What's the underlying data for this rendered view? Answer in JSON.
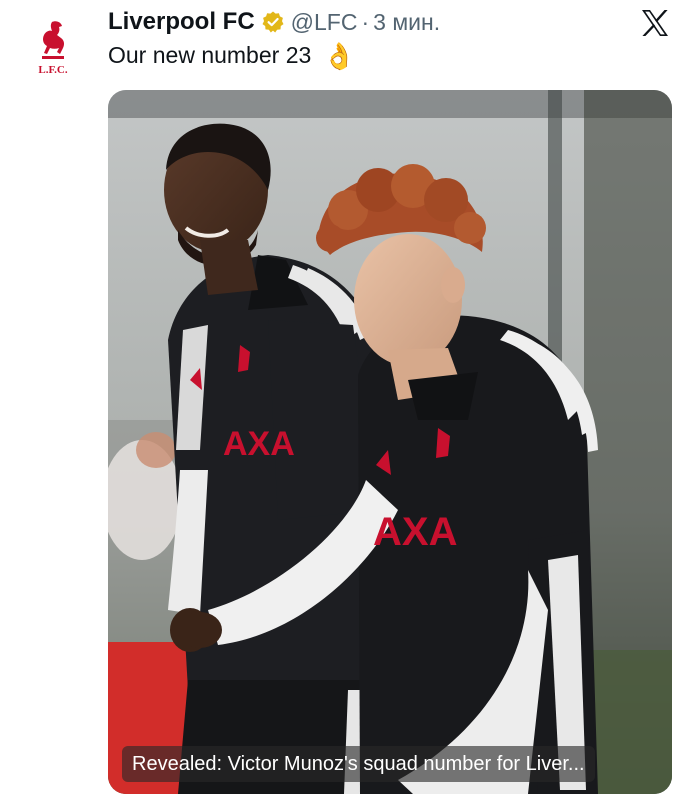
{
  "account": {
    "name": "Liverpool FC",
    "handle": "@LFC",
    "separator": "·",
    "time": "3 мин.",
    "logo_text": "L.F.C."
  },
  "tweet": {
    "text": "Our new number 23",
    "emoji": "👌"
  },
  "media": {
    "caption": "Revealed: Victor Munoz's squad number for Liver..."
  },
  "icons": {
    "verified": "verified-badge-icon",
    "platform": "x-logo-icon"
  },
  "colors": {
    "club_red": "#c8102e",
    "verified_gold": "#e2b719",
    "secondary_text": "#536471"
  }
}
